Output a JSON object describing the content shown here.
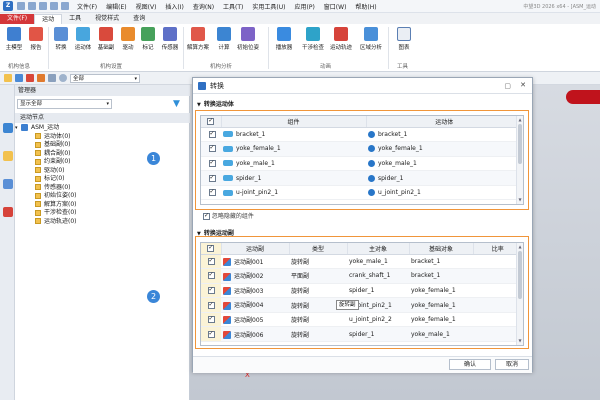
{
  "app": {
    "title": "中望3D 2026 x64 - [ASM_运动",
    "menus": [
      "文件(F)",
      "编辑(E)",
      "视图(V)",
      "插入(I)",
      "查询(N)",
      "工具(T)",
      "实用工具(U)",
      "应用(P)",
      "窗口(W)",
      "帮助(H)"
    ]
  },
  "ribbon": {
    "tabs": [
      "文件(F)",
      "运动",
      "工具",
      "视觉样式",
      "查询"
    ],
    "active_tab": "运动",
    "buttons": [
      {
        "label": "主模型",
        "icon": "main-model-icon"
      },
      {
        "label": "报告",
        "icon": "report-icon"
      },
      {
        "label": "转换",
        "icon": "convert-icon"
      },
      {
        "label": "运动体",
        "icon": "motion-body-icon"
      },
      {
        "label": "基础副",
        "icon": "basic-joint-icon"
      },
      {
        "label": "驱动",
        "icon": "driver-icon"
      },
      {
        "label": "标记",
        "icon": "marker-icon"
      },
      {
        "label": "传感器",
        "icon": "sensor-icon"
      },
      {
        "label": "解算方案",
        "icon": "solution-icon"
      },
      {
        "label": "计算",
        "icon": "calculate-icon"
      },
      {
        "label": "初始位姿",
        "icon": "initial-pose-icon"
      },
      {
        "label": "播放器",
        "icon": "player-icon"
      },
      {
        "label": "干涉检查",
        "icon": "interference-icon"
      },
      {
        "label": "运动轨迹",
        "icon": "trajectory-icon"
      },
      {
        "label": "区域分析",
        "icon": "region-icon"
      },
      {
        "label": "图表",
        "icon": "chart-icon"
      }
    ],
    "groups": [
      "机构信息",
      "机构设置",
      "机构分析",
      "动画",
      "工具"
    ]
  },
  "toolbar": {
    "filter_value": "全部"
  },
  "manager": {
    "title": "管理器",
    "display_combo": "显示全部",
    "tree_header": "运动节点",
    "tree_root": "ASM_运动",
    "tree_items": [
      "运动体(0)",
      "基础副(0)",
      "耦合副(0)",
      "约束副(0)",
      "驱动(0)",
      "标记(0)",
      "传感器(0)",
      "初始位姿(0)",
      "解算方案(0)",
      "干涉检查(0)",
      "运动轨迹(0)"
    ]
  },
  "dialog": {
    "title": "转换",
    "section1_title": "转换运动体",
    "section2_title": "转换运动副",
    "bodies_columns": [
      "组件",
      "运动体"
    ],
    "bodies": [
      {
        "component": "bracket_1",
        "body": "bracket_1"
      },
      {
        "component": "yoke_female_1",
        "body": "yoke_female_1"
      },
      {
        "component": "yoke_male_1",
        "body": "yoke_male_1"
      },
      {
        "component": "spider_1",
        "body": "spider_1"
      },
      {
        "component": "u-joint_pin2_1",
        "body": "u_joint_pin2_1"
      }
    ],
    "ignore_label": "忽略隐藏的组件",
    "joints_columns": [
      "运动副",
      "类型",
      "主对象",
      "基础对象",
      "比率"
    ],
    "joints": [
      {
        "name": "运动副001",
        "type": "旋转副",
        "main": "yoke_male_1",
        "base": "bracket_1",
        "ratio": ""
      },
      {
        "name": "运动副002",
        "type": "平面副",
        "main": "crank_shaft_1",
        "base": "bracket_1",
        "ratio": ""
      },
      {
        "name": "运动副003",
        "type": "旋转副",
        "main": "spider_1",
        "base": "yoke_female_1",
        "ratio": ""
      },
      {
        "name": "运动副004",
        "type": "旋转副",
        "main": "u_joint_pin2_1",
        "base": "yoke_female_1",
        "ratio": ""
      },
      {
        "name": "运动副005",
        "type": "旋转副",
        "main": "u_joint_pin2_2",
        "base": "yoke_female_1",
        "ratio": ""
      },
      {
        "name": "运动副006",
        "type": "旋转副",
        "main": "spider_1",
        "base": "yoke_male_1",
        "ratio": ""
      }
    ],
    "tooltip": "旋转副",
    "ok_label": "确认",
    "cancel_label": "取消"
  },
  "annotations": {
    "badge1": "1",
    "badge2": "2",
    "highlight_color": "#f0953a",
    "badge_color": "#3a86d8"
  },
  "viewport": {
    "axis_label": "X"
  }
}
